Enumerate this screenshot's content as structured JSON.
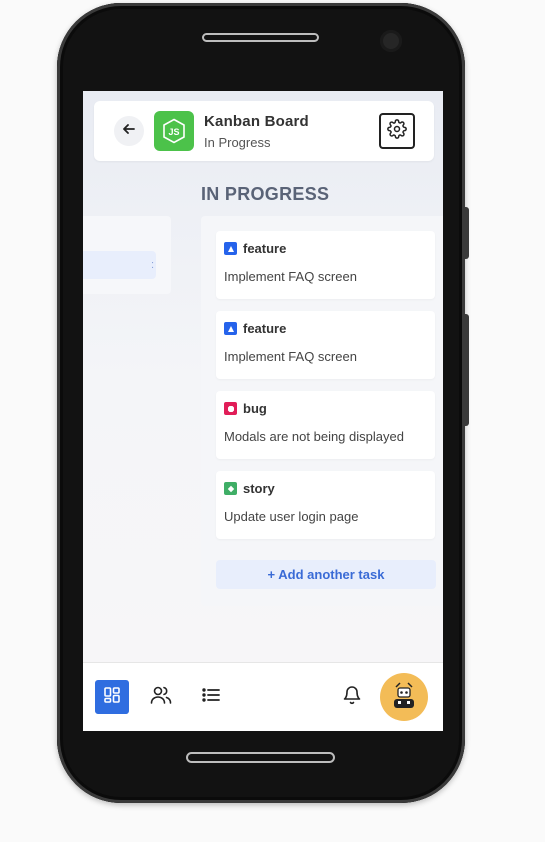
{
  "header": {
    "title": "Kanban Board",
    "subtitle": "In Progress",
    "back_icon": "arrow-left-icon",
    "logo_icon": "nodejs-logo",
    "settings_icon": "gear-icon"
  },
  "column": {
    "title": "IN PROGRESS",
    "cards": [
      {
        "type": "feature",
        "type_color": "#2563eb",
        "title": "Implement FAQ screen"
      },
      {
        "type": "feature",
        "type_color": "#2563eb",
        "title": "Implement FAQ screen"
      },
      {
        "type": "bug",
        "type_color": "#e11d58",
        "title": "Modals are not being displayed"
      },
      {
        "type": "story",
        "type_color": "#3fae66",
        "title": "Update user login page"
      }
    ],
    "add_task_label": "+ Add another task"
  },
  "nav": {
    "items": [
      "board-icon",
      "users-icon",
      "list-icon",
      "bell-icon",
      "avatar"
    ]
  },
  "colors": {
    "accent": "#2f6de0",
    "logo_bg": "#4cc24a",
    "avatar_bg": "#f3bc57"
  }
}
